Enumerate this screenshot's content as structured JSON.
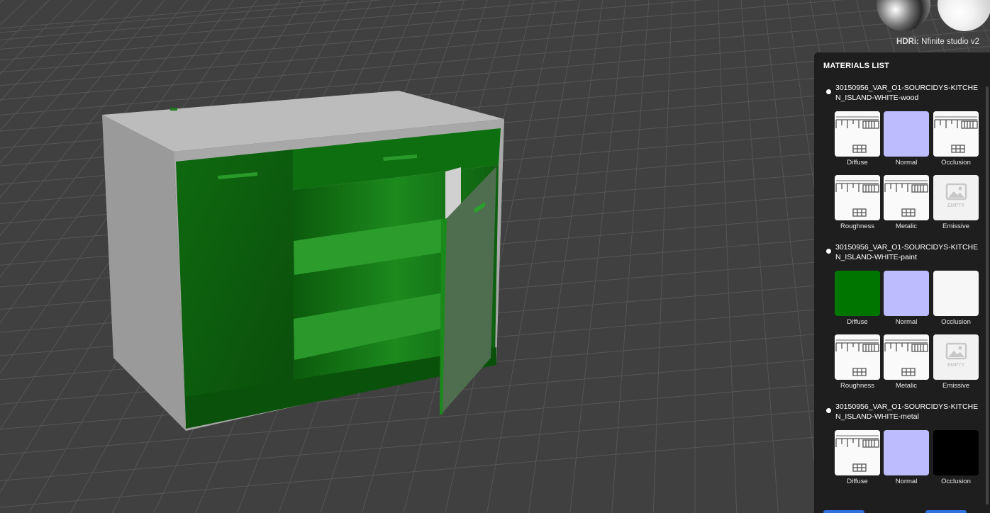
{
  "hdri": {
    "prefix": "HDRi:",
    "name": "Nfinite studio v2"
  },
  "panel": {
    "title": "MATERIALS LIST",
    "materials": [
      {
        "name": "30150956_VAR_O1-SOURCIDYS-KITCHEN_ISLAND-WHITE-wood",
        "textures": [
          {
            "label": "Diffuse",
            "kind": "image"
          },
          {
            "label": "Normal",
            "kind": "flat-normal"
          },
          {
            "label": "Occlusion",
            "kind": "image"
          },
          {
            "label": "Roughness",
            "kind": "image"
          },
          {
            "label": "Metalic",
            "kind": "image"
          },
          {
            "label": "Emissive",
            "kind": "empty"
          }
        ]
      },
      {
        "name": "30150956_VAR_O1-SOURCIDYS-KITCHEN_ISLAND-WHITE-paint",
        "textures": [
          {
            "label": "Diffuse",
            "kind": "flat-green"
          },
          {
            "label": "Normal",
            "kind": "flat-normal"
          },
          {
            "label": "Occlusion",
            "kind": "flat-white"
          },
          {
            "label": "Roughness",
            "kind": "image"
          },
          {
            "label": "Metalic",
            "kind": "image"
          },
          {
            "label": "Emissive",
            "kind": "empty"
          }
        ]
      },
      {
        "name": "30150956_VAR_O1-SOURCIDYS-KITCHEN_ISLAND-WHITE-metal",
        "textures": [
          {
            "label": "Diffuse",
            "kind": "image"
          },
          {
            "label": "Normal",
            "kind": "flat-normal"
          },
          {
            "label": "Occlusion",
            "kind": "flat-black"
          }
        ]
      }
    ]
  },
  "empty_badge": "EMPTY",
  "colors": {
    "accent": "#2f6fe0",
    "paint_green": "#007500",
    "normal_map": "#bcbcff",
    "background": "#404040",
    "panel": "#1e1e1e"
  }
}
